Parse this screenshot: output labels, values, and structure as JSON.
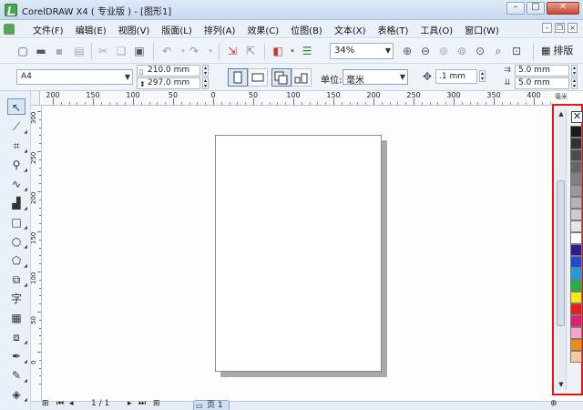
{
  "window": {
    "title": "CorelDRAW X4 ( 专业版 ) - [图形1]",
    "minimize_glyph": "–",
    "maximize_glyph": "□",
    "close_glyph": "✕"
  },
  "menu": {
    "items": [
      "文件(F)",
      "编辑(E)",
      "视图(V)",
      "版面(L)",
      "排列(A)",
      "效果(C)",
      "位图(B)",
      "文本(X)",
      "表格(T)",
      "工具(O)",
      "窗口(W)"
    ]
  },
  "toolbar": {
    "zoom_value": "34%",
    "layout_label": "排版"
  },
  "propbar": {
    "paper_size": "A4",
    "width_value": "210.0 mm",
    "height_value": "297.0 mm",
    "units_label": "单位:",
    "units_value": "毫米",
    "nudge_value": ".1 mm",
    "dup_x_value": "5.0 mm",
    "dup_y_value": "5.0 mm"
  },
  "rulers": {
    "unit_label": "毫米",
    "h_labels": [
      "200",
      "150",
      "100",
      "50",
      "0",
      "50",
      "100",
      "150",
      "200",
      "250",
      "300",
      "350",
      "400"
    ],
    "v_labels": [
      "300",
      "250",
      "200",
      "150",
      "100",
      "50",
      "0"
    ]
  },
  "palette": {
    "colors": [
      "#1a1a1a",
      "#333333",
      "#4d4d4d",
      "#666666",
      "#808080",
      "#999999",
      "#b3b3b3",
      "#cccccc",
      "#e6e6e6",
      "#ffffff",
      "#2b1f8f",
      "#1c4fd6",
      "#1aa0e0",
      "#1fb04a",
      "#f5ea14",
      "#e31e24",
      "#e11d74",
      "#f4a6c8",
      "#f28a1a",
      "#f9c9a0"
    ]
  },
  "status": {
    "page_counter": "1 / 1",
    "page_tab_label": "页 1"
  }
}
